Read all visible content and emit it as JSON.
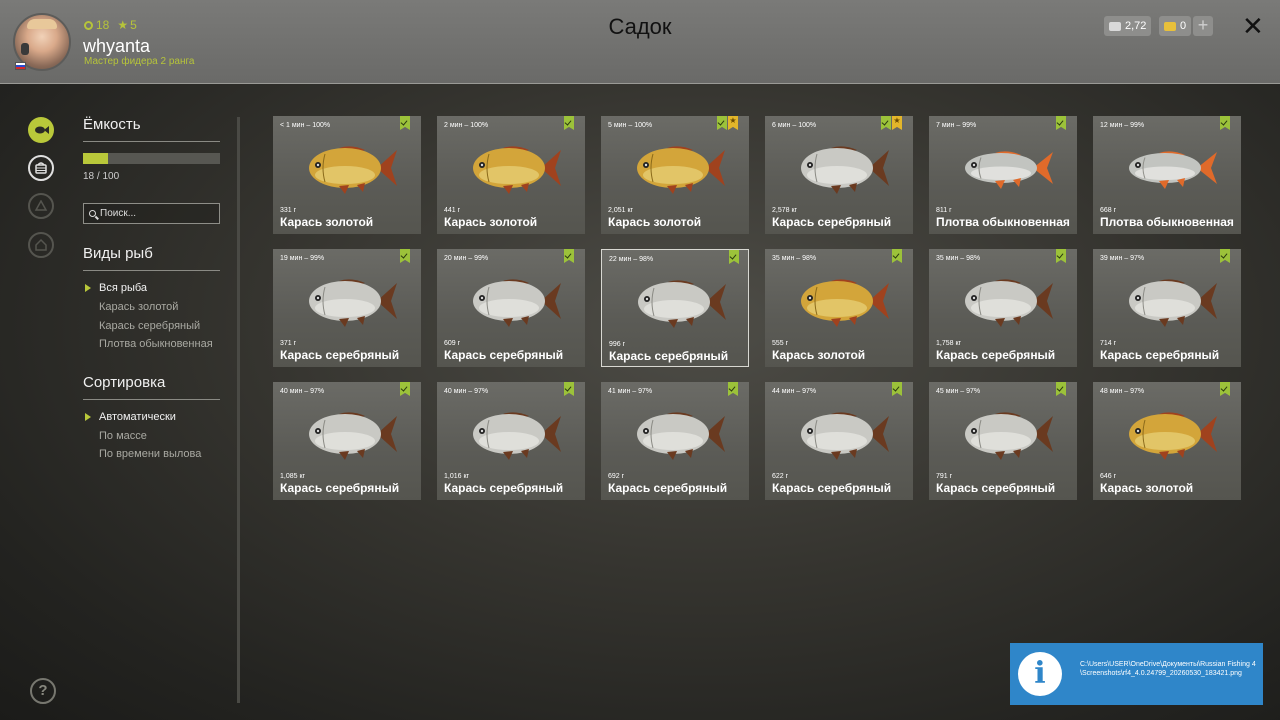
{
  "window": {
    "title": "Садок",
    "close_label": "✕"
  },
  "user": {
    "name": "whyanta",
    "rank": "Мастер фидера 2 ранга",
    "level": "18",
    "stars": "5"
  },
  "currency": {
    "silver": "2,72",
    "gold": "0",
    "add_label": "+"
  },
  "nav_icons": [
    {
      "name": "keepnet-fish-icon",
      "state": "active"
    },
    {
      "name": "basket-icon",
      "state": "selected"
    },
    {
      "name": "boat-icon",
      "state": "disabled"
    },
    {
      "name": "home-icon",
      "state": "disabled"
    }
  ],
  "capacity": {
    "heading": "Ёмкость",
    "text": "18 / 100",
    "fraction": 0.18
  },
  "search": {
    "placeholder": "Поиск..."
  },
  "species": {
    "heading": "Виды рыб",
    "items": [
      "Вся рыба",
      "Карась золотой",
      "Карась серебряный",
      "Плотва обыкновенная"
    ],
    "selected": 0
  },
  "sort": {
    "heading": "Сортировка",
    "items": [
      "Автоматически",
      "По массе",
      "По времени вылова"
    ],
    "selected": 0
  },
  "colors": {
    "accent": "#b9c83a",
    "gold_fish": "#d7a83a",
    "silver_fish": "#c8c8c4",
    "roach_fin": "#e06a2a"
  },
  "fish": [
    {
      "time": "< 1 мин – 100%",
      "weight": "331 г",
      "name": "Карась золотой",
      "kind": "gold",
      "star": false
    },
    {
      "time": "2 мин – 100%",
      "weight": "441 г",
      "name": "Карась золотой",
      "kind": "gold",
      "star": false
    },
    {
      "time": "5 мин – 100%",
      "weight": "2,051 кг",
      "name": "Карась золотой",
      "kind": "gold",
      "star": true
    },
    {
      "time": "6 мин – 100%",
      "weight": "2,578 кг",
      "name": "Карась серебряный",
      "kind": "silver",
      "star": true
    },
    {
      "time": "7 мин – 99%",
      "weight": "811 г",
      "name": "Плотва обыкновенная",
      "kind": "roach",
      "star": false
    },
    {
      "time": "12 мин – 99%",
      "weight": "668 г",
      "name": "Плотва обыкновенная",
      "kind": "roach",
      "star": false
    },
    {
      "time": "19 мин – 99%",
      "weight": "371 г",
      "name": "Карась серебряный",
      "kind": "silver",
      "star": false
    },
    {
      "time": "20 мин – 99%",
      "weight": "609 г",
      "name": "Карась серебряный",
      "kind": "silver",
      "star": false
    },
    {
      "time": "22 мин – 98%",
      "weight": "996 г",
      "name": "Карась серебряный",
      "kind": "silver",
      "star": false
    },
    {
      "time": "35 мин – 98%",
      "weight": "555 г",
      "name": "Карась золотой",
      "kind": "gold",
      "star": false
    },
    {
      "time": "35 мин – 98%",
      "weight": "1,758 кг",
      "name": "Карась серебряный",
      "kind": "silver",
      "star": false
    },
    {
      "time": "39 мин – 97%",
      "weight": "714 г",
      "name": "Карась серебряный",
      "kind": "silver",
      "star": false
    },
    {
      "time": "40 мин – 97%",
      "weight": "1,085 кг",
      "name": "Карась серебряный",
      "kind": "silver",
      "star": false
    },
    {
      "time": "40 мин – 97%",
      "weight": "1,016 кг",
      "name": "Карась серебряный",
      "kind": "silver",
      "star": false
    },
    {
      "time": "41 мин – 97%",
      "weight": "692 г",
      "name": "Карась серебряный",
      "kind": "silver",
      "star": false
    },
    {
      "time": "44 мин – 97%",
      "weight": "622 г",
      "name": "Карась серебряный",
      "kind": "silver",
      "star": false
    },
    {
      "time": "45 мин – 97%",
      "weight": "791 г",
      "name": "Карась серебряный",
      "kind": "silver",
      "star": false
    },
    {
      "time": "48 мин – 97%",
      "weight": "646 г",
      "name": "Карась золотой",
      "kind": "gold",
      "star": false
    }
  ],
  "selected_fish": 8,
  "notification": {
    "path": "C:\\Users\\USER\\OneDrive\\Документы\\Russian Fishing 4\\Screenshots\\rf4_4.0.24799_20260530_183421.png"
  }
}
